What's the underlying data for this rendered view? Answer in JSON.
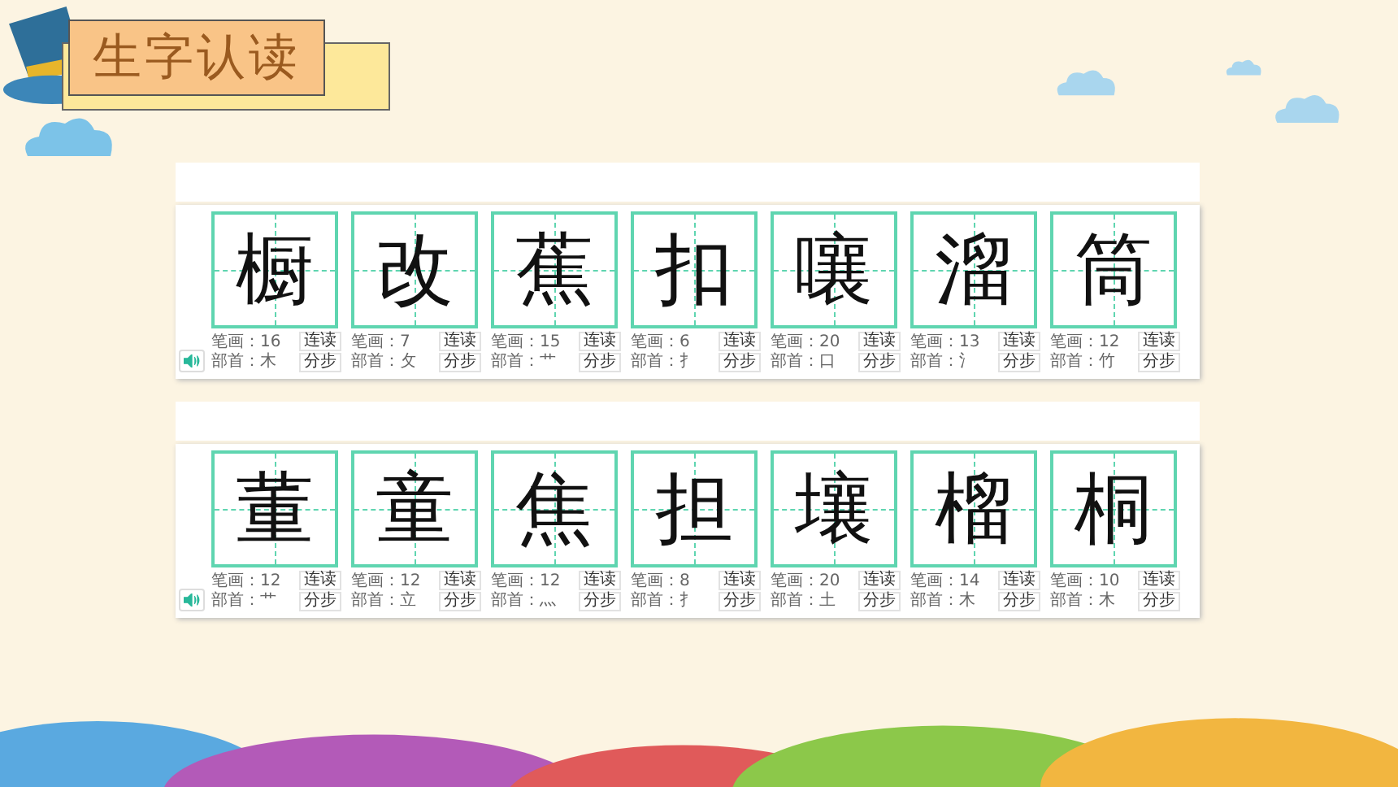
{
  "title": "生字认读",
  "rows": [
    {
      "cards": [
        {
          "char": "橱",
          "strokes": "笔画：16",
          "radical": "部首：木",
          "buttons": [
            "连读",
            "分步"
          ]
        },
        {
          "char": "改",
          "strokes": "笔画：7",
          "radical": "部首：攵",
          "buttons": [
            "连读",
            "分步"
          ]
        },
        {
          "char": "蕉",
          "strokes": "笔画：15",
          "radical": "部首：艹",
          "buttons": [
            "连读",
            "分步"
          ]
        },
        {
          "char": "扣",
          "strokes": "笔画：6",
          "radical": "部首：扌",
          "buttons": [
            "连读",
            "分步"
          ]
        },
        {
          "char": "嚷",
          "strokes": "笔画：20",
          "radical": "部首：口",
          "buttons": [
            "连读",
            "分步"
          ]
        },
        {
          "char": "溜",
          "strokes": "笔画：13",
          "radical": "部首：氵",
          "buttons": [
            "连读",
            "分步"
          ]
        },
        {
          "char": "筒",
          "strokes": "笔画：12",
          "radical": "部首：竹",
          "buttons": [
            "连读",
            "分步"
          ]
        }
      ]
    },
    {
      "cards": [
        {
          "char": "董",
          "strokes": "笔画：12",
          "radical": "部首：艹",
          "buttons": [
            "连读",
            "分步"
          ]
        },
        {
          "char": "童",
          "strokes": "笔画：12",
          "radical": "部首：立",
          "buttons": [
            "连读",
            "分步"
          ]
        },
        {
          "char": "焦",
          "strokes": "笔画：12",
          "radical": "部首：灬",
          "buttons": [
            "连读",
            "分步"
          ]
        },
        {
          "char": "担",
          "strokes": "笔画：8",
          "radical": "部首：扌",
          "buttons": [
            "连读",
            "分步"
          ]
        },
        {
          "char": "壤",
          "strokes": "笔画：20",
          "radical": "部首：土",
          "buttons": [
            "连读",
            "分步"
          ]
        },
        {
          "char": "榴",
          "strokes": "笔画：14",
          "radical": "部首：木",
          "buttons": [
            "连读",
            "分步"
          ]
        },
        {
          "char": "桐",
          "strokes": "笔画：10",
          "radical": "部首：木",
          "buttons": [
            "连读",
            "分步"
          ]
        }
      ]
    }
  ]
}
